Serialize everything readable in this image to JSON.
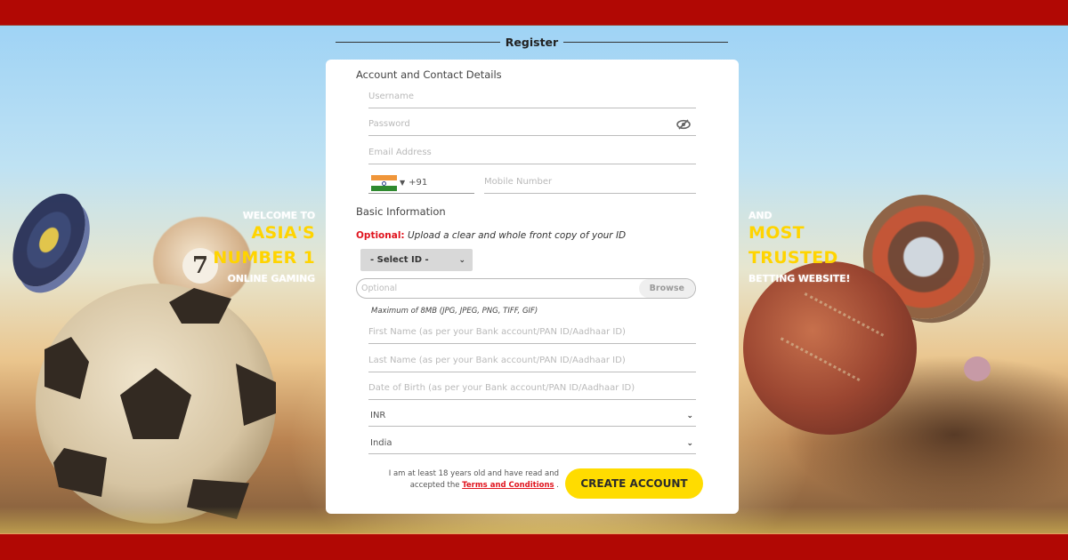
{
  "header": {
    "title": "Register"
  },
  "promo": {
    "left": {
      "line1": "WELCOME TO",
      "line2": "ASIA'S",
      "line3": "NUMBER 1",
      "line4": "ONLINE GAMING"
    },
    "right": {
      "line1": "AND",
      "line2": "MOST",
      "line3": "TRUSTED",
      "line4": "BETTING WEBSITE!"
    }
  },
  "background": {
    "billiard_number": "7"
  },
  "form": {
    "account_section": "Account and Contact Details",
    "username_placeholder": "Username",
    "password_placeholder": "Password",
    "email_placeholder": "Email Address",
    "phone": {
      "country_flag": "india-flag",
      "dial_code": "+91",
      "mobile_placeholder": "Mobile Number"
    },
    "basic_section": "Basic Information",
    "optional_label": "Optional:",
    "optional_message": "Upload a clear and whole front copy of your ID",
    "select_id": "- Select ID -",
    "upload_placeholder": "Optional",
    "browse_label": "Browse",
    "max_note": "Maximum of 8MB (JPG, JPEG, PNG, TIFF, GIF)",
    "first_name_placeholder": "First Name (as per your Bank account/PAN ID/Aadhaar ID)",
    "last_name_placeholder": "Last Name (as per your Bank account/PAN ID/Aadhaar ID)",
    "dob_placeholder": "Date of Birth (as per your Bank account/PAN ID/Aadhaar ID)",
    "currency": "INR",
    "country": "India",
    "consent_text": "I am at least 18 years old and have read and accepted the",
    "terms_link": "Terms and Conditions",
    "consent_end": ".",
    "create_button": "CREATE ACCOUNT"
  },
  "colors": {
    "brand_red": "#b10804",
    "accent_yellow": "#ffdc00",
    "optional_red": "#e0141e"
  }
}
